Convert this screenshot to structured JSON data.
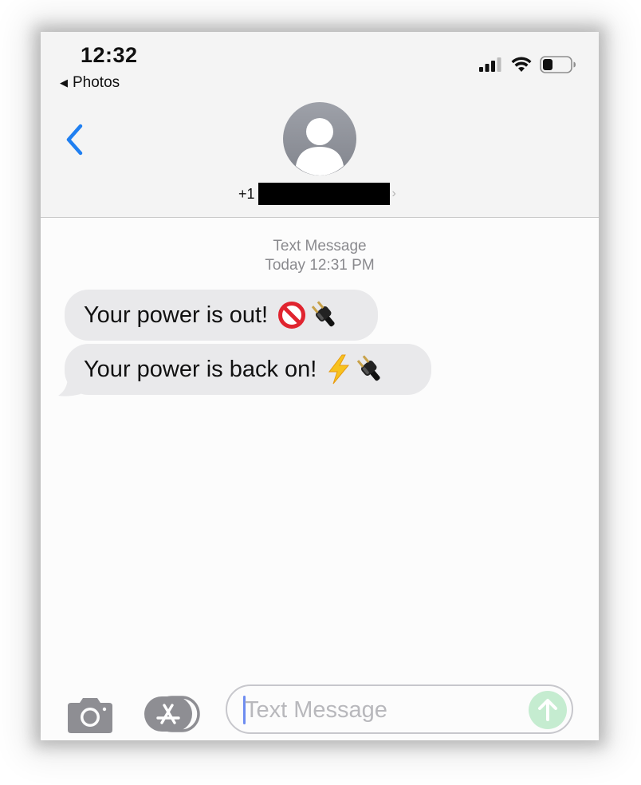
{
  "status_bar": {
    "time": "12:32",
    "back_app": "Photos"
  },
  "header": {
    "contact_prefix": "+1"
  },
  "conversation": {
    "service": "Text Message",
    "timestamp": "Today 12:31 PM",
    "messages": [
      {
        "text": "Your power is out!",
        "emoji": "🚫🔌"
      },
      {
        "text": "Your power is back on!",
        "emoji": "⚡🔌"
      }
    ]
  },
  "composer": {
    "placeholder": "Text Message",
    "value": ""
  },
  "icons": {
    "signal": "cellular-signal-icon",
    "wifi": "wifi-icon",
    "battery": "battery-icon",
    "back": "chevron-left-icon",
    "avatar": "person-icon",
    "camera": "camera-icon",
    "apps": "app-store-icon",
    "send": "arrow-up-icon"
  },
  "colors": {
    "accent": "#1f7ff1",
    "bubble_incoming": "#e9e9eb",
    "send_disabled": "#c5ecd0",
    "avatar": "#8e9199"
  }
}
